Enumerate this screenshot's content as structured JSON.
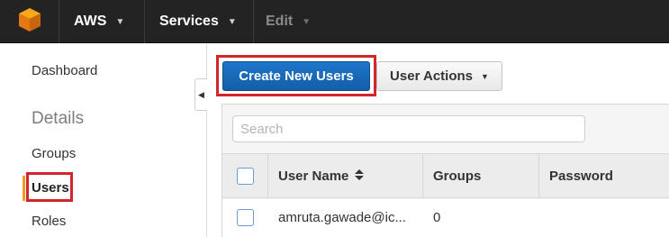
{
  "topnav": {
    "logo_icon": "aws-cube-icon",
    "aws_label": "AWS",
    "services_label": "Services",
    "edit_label": "Edit"
  },
  "sidebar": {
    "items": [
      {
        "label": "Dashboard"
      },
      {
        "label": "Groups"
      },
      {
        "label": "Users",
        "active": true
      },
      {
        "label": "Roles"
      }
    ],
    "heading": "Details"
  },
  "toolbar": {
    "create_label": "Create New Users",
    "actions_label": "User Actions"
  },
  "search": {
    "placeholder": "Search",
    "value": ""
  },
  "table": {
    "columns": [
      "User Name",
      "Groups",
      "Password"
    ],
    "rows": [
      {
        "user_name": "amruta.gawade@ic...",
        "groups": "0",
        "password": ""
      }
    ]
  },
  "colors": {
    "accent_blue": "#1f76c9",
    "highlight_red": "#d1262b",
    "active_orange": "#f29c22",
    "nav_bg": "#232323"
  }
}
